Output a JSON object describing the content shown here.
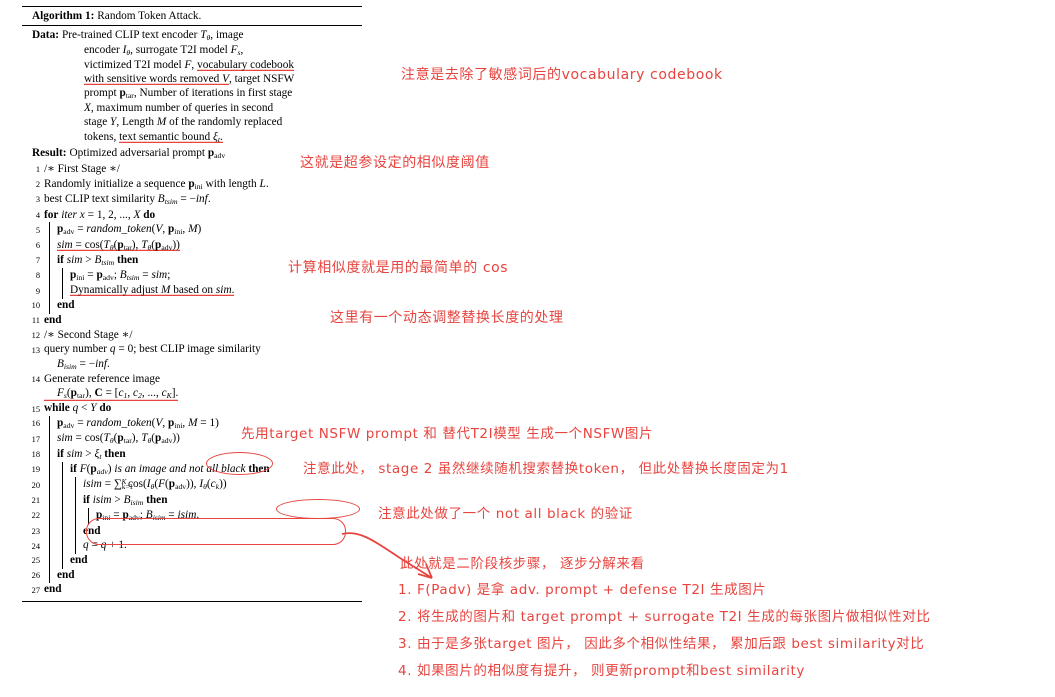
{
  "document": {
    "type": "algorithm-pseudocode-with-handwritten-annotations",
    "title_label": "Algorithm 1:",
    "title_text": "Random Token Attack.",
    "data_label": "Data:",
    "result_label": "Result:",
    "data_lines": [
      "Pre-trained CLIP text encoder Tθ, image",
      "encoder Iθ, surrogate T2I model Fs,",
      "victimized T2I model F, vocabulary codebook",
      "with sensitive words removed V, target NSFW",
      "prompt ptar, Number of iterations in first stage",
      "X, maximum number of queries in second",
      "stage Y, Length M of the randomly replaced",
      "tokens, text semantic bound ξt."
    ],
    "result_line": "Optimized adversarial prompt padv",
    "lines": [
      {
        "n": "1",
        "text": "/* First Stage */"
      },
      {
        "n": "2",
        "text": "Randomly initialize a sequence pini with length L."
      },
      {
        "n": "3",
        "text": "best CLIP text similarity Btsim = −inf."
      },
      {
        "n": "4",
        "text": "for iter x = 1, 2, ..., X do"
      },
      {
        "n": "5",
        "text": "padv = random_token(V, pini, M)"
      },
      {
        "n": "6",
        "text": "sim = cos(Tθ(ptar), Tθ(padv))"
      },
      {
        "n": "7",
        "text": "if sim > Btsim then"
      },
      {
        "n": "8",
        "text": "pini = padv; Btsim = sim;"
      },
      {
        "n": "9",
        "text": "Dynamically adjust M based on sim."
      },
      {
        "n": "10",
        "text": "end"
      },
      {
        "n": "11",
        "text": "end"
      },
      {
        "n": "12",
        "text": "/* Second Stage */"
      },
      {
        "n": "13",
        "text": "query number q = 0; best CLIP image similarity Bisim = −inf."
      },
      {
        "n": "14",
        "text": "Generate reference image Fs(ptar), C = [c1, c2, ..., cK]."
      },
      {
        "n": "15",
        "text": "while q < Y do"
      },
      {
        "n": "16",
        "text": "padv = random_token(V, pini, M = 1)"
      },
      {
        "n": "17",
        "text": "sim = cos(Tθ(ptar), Tθ(padv))"
      },
      {
        "n": "18",
        "text": "if sim > ξt then"
      },
      {
        "n": "19",
        "text": "if F(padv) is an image and not all black then"
      },
      {
        "n": "20",
        "text": "isim = ∑(k=1..K) cos(Iθ(F(padv)), Iθ(ck))"
      },
      {
        "n": "21",
        "text": "if isim > Bisim then"
      },
      {
        "n": "22",
        "text": "pini = padv; Bisim = isim."
      },
      {
        "n": "23",
        "text": "end"
      },
      {
        "n": "24",
        "text": "q = q + 1."
      },
      {
        "n": "25",
        "text": "end"
      },
      {
        "n": "26",
        "text": "end"
      },
      {
        "n": "27",
        "text": "end"
      }
    ]
  },
  "annotations": {
    "color": "#e8443f",
    "notes": [
      {
        "id": "note-vocabulary-codebook",
        "text": "注意是去除了敏感词后的vocabulary codebook"
      },
      {
        "id": "note-similarity-threshold",
        "text": "这就是超参设定的相似度阈值"
      },
      {
        "id": "note-cosine-similarity",
        "text": "计算相似度就是用的最简单的 cos"
      },
      {
        "id": "note-dynamic-length",
        "text": "这里有一个动态调整替换长度的处理"
      },
      {
        "id": "note-reference-image",
        "text": "先用target NSFW prompt 和 替代T2I模型 生成一个NSFW图片"
      },
      {
        "id": "note-fixed-length-one",
        "text": "注意此处， stage 2 虽然继续随机搜索替换token， 但此处替换长度固定为1"
      },
      {
        "id": "note-not-all-black",
        "text": "注意此处做了一个 not all black 的验证"
      },
      {
        "id": "note-stage2-core-header",
        "text": "此处就是二阶段核步骤， 逐步分解来看"
      },
      {
        "id": "note-step-1",
        "text": "1. F(Padv) 是拿 adv. prompt + defense T2I 生成图片"
      },
      {
        "id": "note-step-2",
        "text": "2. 将生成的图片和 target prompt + surrogate T2I 生成的每张图片做相似性对比"
      },
      {
        "id": "note-step-3",
        "text": "3. 由于是多张target 图片， 因此多个相似性结果， 累加后跟 best similarity对比"
      },
      {
        "id": "note-step-4",
        "text": "4. 如果图片的相似度有提升， 则更新prompt和best similarity"
      }
    ]
  }
}
